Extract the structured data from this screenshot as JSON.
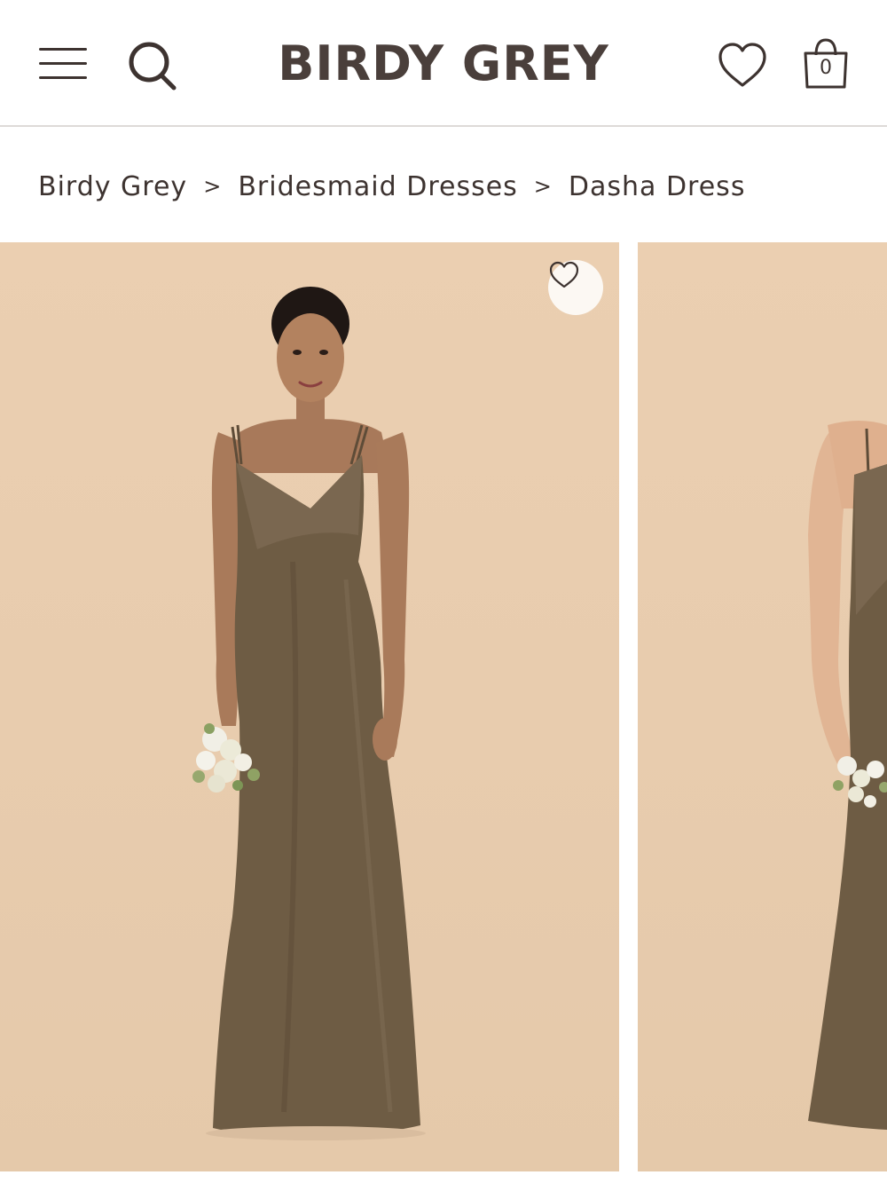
{
  "header": {
    "brand": "BIRDY GREY",
    "cart_count": "0",
    "icons": [
      "hamburger-menu-icon",
      "search-icon",
      "heart-icon",
      "shopping-bag-icon"
    ]
  },
  "breadcrumb": {
    "items": [
      "Birdy Grey",
      "Bridesmaid Dresses",
      "Dasha Dress"
    ],
    "separator": ">"
  },
  "gallery": {
    "favorite_icon": "heart-outline-icon",
    "images": [
      "product-photo-front",
      "product-photo-side"
    ]
  },
  "colors": {
    "text": "#3d3330",
    "background_photo": "#e9cdb0",
    "dress": "#6e5c44",
    "divider": "#dedad8"
  }
}
